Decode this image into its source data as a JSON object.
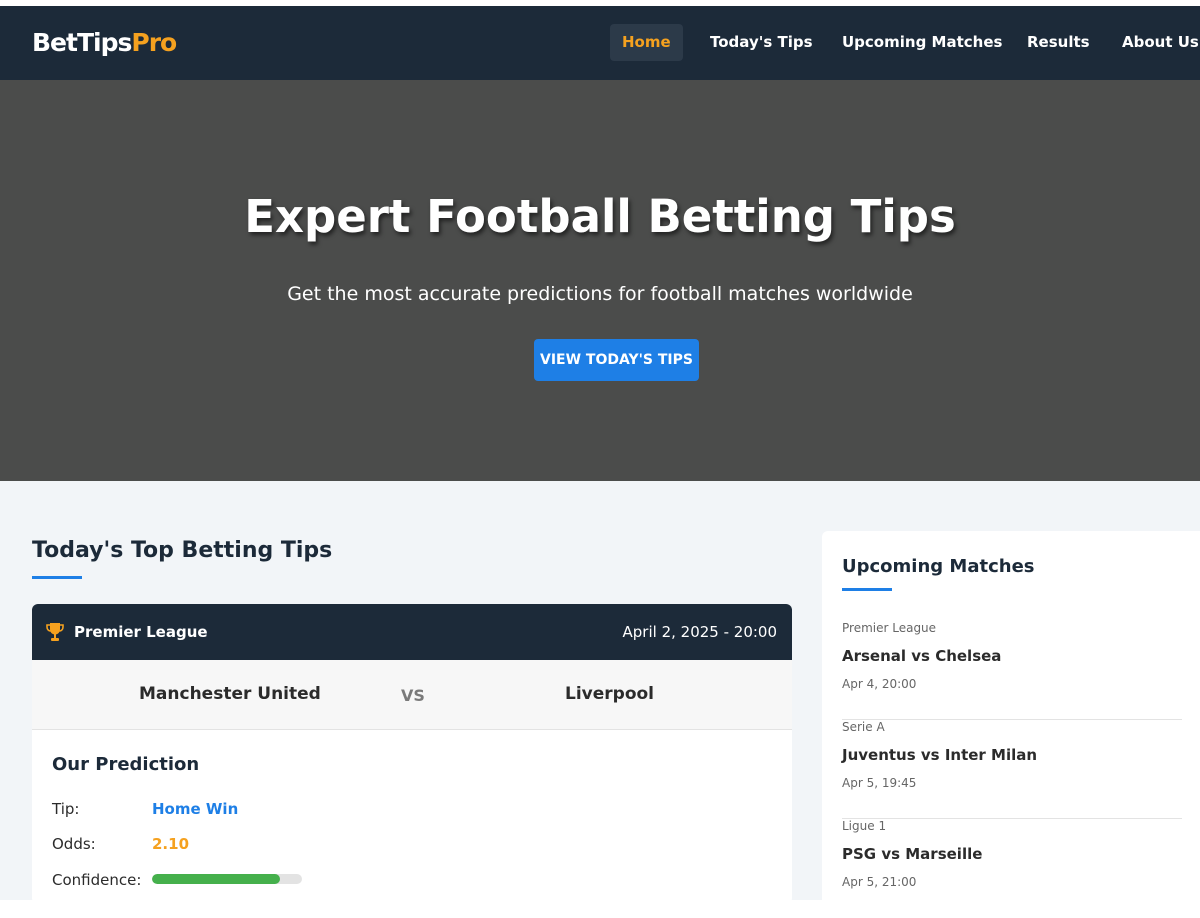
{
  "nav": {
    "logo_main": "BetTips",
    "logo_accent": "Pro",
    "items": [
      {
        "label": "Home"
      },
      {
        "label": "Today's Tips"
      },
      {
        "label": "Upcoming Matches"
      },
      {
        "label": "Results"
      },
      {
        "label": "About Us"
      }
    ],
    "active": "Home"
  },
  "hero": {
    "title": "Expert Football Betting Tips",
    "subtitle": "Get the most accurate predictions for football matches worldwide",
    "button": "VIEW TODAY'S TIPS"
  },
  "tips_section": {
    "title": "Today's Top Betting Tips",
    "card": {
      "league_icon": "trophy-icon",
      "league": "Premier League",
      "datetime": "April 2, 2025 - 20:00",
      "home_team": "Manchester United",
      "vs": "VS",
      "away_team": "Liverpool",
      "prediction_title": "Our Prediction",
      "tip_label": "Tip:",
      "tip_value": "Home Win",
      "odds_label": "Odds:",
      "odds_value": "2.10",
      "confidence_label": "Confidence:",
      "confidence_percent": 85
    }
  },
  "sidebar": {
    "title": "Upcoming Matches",
    "matches": [
      {
        "league": "Premier League",
        "teams": "Arsenal vs Chelsea",
        "date": "Apr 4, 20:00"
      },
      {
        "league": "Serie A",
        "teams": "Juventus vs Inter Milan",
        "date": "Apr 5, 19:45"
      },
      {
        "league": "Ligue 1",
        "teams": "PSG vs Marseille",
        "date": "Apr 5, 21:00"
      }
    ]
  },
  "colors": {
    "navy": "#1c2a39",
    "accent_orange": "#f5a11f",
    "accent_blue": "#1e7fe6",
    "confidence_green": "#45b04c"
  }
}
